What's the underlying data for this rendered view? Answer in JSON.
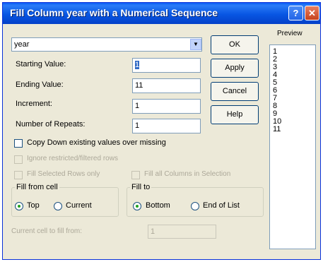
{
  "window": {
    "title": "Fill Column year with a Numerical Sequence",
    "help_glyph": "?",
    "close_glyph": "✕"
  },
  "column_select": {
    "value": "year",
    "arrow": "▼"
  },
  "fields": {
    "starting_value": {
      "label": "Starting Value:",
      "value": "1"
    },
    "ending_value": {
      "label": "Ending Value:",
      "value": "11"
    },
    "increment": {
      "label": "Increment:",
      "value": "1"
    },
    "number_of_repeats": {
      "label": "Number of Repeats:",
      "value": "1"
    }
  },
  "buttons": {
    "ok": "OK",
    "apply": "Apply",
    "cancel": "Cancel",
    "help": "Help"
  },
  "checkboxes": {
    "copy_down": "Copy Down existing values over missing",
    "ignore_restricted": "Ignore restricted/filtered rows",
    "fill_selected_rows": "Fill Selected Rows only",
    "fill_all_columns": "Fill all Columns in Selection"
  },
  "fill_from_cell": {
    "title": "Fill from cell",
    "options": [
      "Top",
      "Current"
    ],
    "selected": "Top"
  },
  "fill_to": {
    "title": "Fill to",
    "options": [
      "Bottom",
      "End of List"
    ],
    "selected": "Bottom"
  },
  "current_cell": {
    "label": "Current cell to fill from:",
    "value": "1"
  },
  "preview": {
    "label": "Preview",
    "items": [
      "1",
      "2",
      "3",
      "4",
      "5",
      "6",
      "7",
      "8",
      "9",
      "10",
      "11"
    ]
  }
}
